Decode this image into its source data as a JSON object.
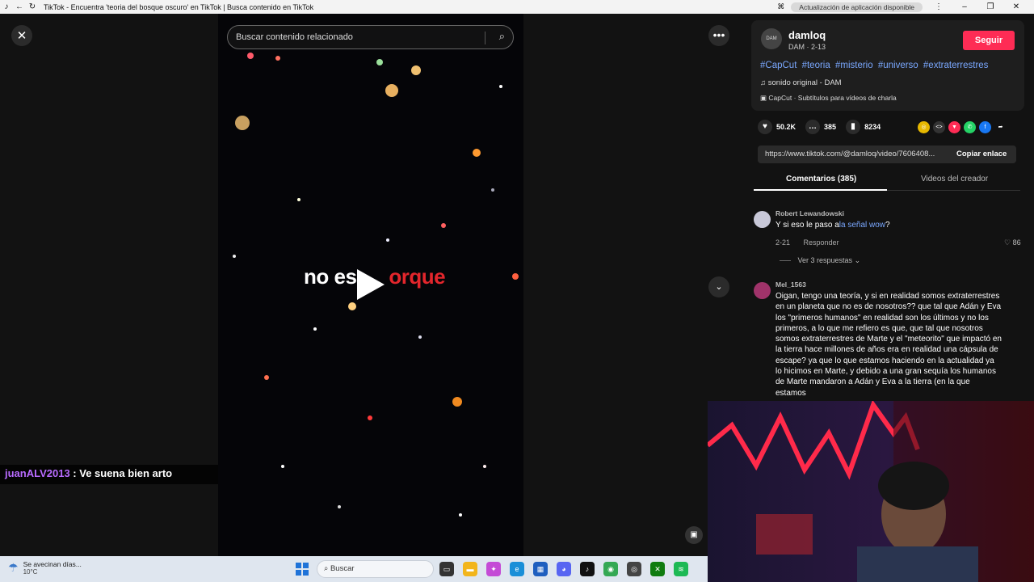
{
  "window": {
    "title": "TikTok - Encuentra 'teoria del bosque oscuro' en TikTok | Busca contenido en TikTok",
    "update_notice": "Actualización de aplicación disponible"
  },
  "video": {
    "search_placeholder": "Buscar contenido relacionado",
    "caption_part1": "no es",
    "caption_part2": "orque",
    "chat_user": "juanALV2013",
    "chat_message": " : Ve suena bien arto"
  },
  "creator": {
    "name": "damloq",
    "sub": "DAM · 2-13",
    "avatar_text": "DAM",
    "follow_label": "Seguir",
    "hashtags": [
      "#CapCut",
      "#teoria",
      "#misterio",
      "#universo",
      "#extraterrestres"
    ],
    "sound": "sonido original - DAM",
    "capcut": "CapCut · Subtítulos para vídeos de charla"
  },
  "stats": {
    "likes": "50.2K",
    "comments": "385",
    "saves": "8234"
  },
  "link": {
    "url": "https://www.tiktok.com/@damloq/video/7606408...",
    "copy_label": "Copiar enlace"
  },
  "tabs": {
    "comments": "Comentarios (385)",
    "creator_videos": "Videos del creador"
  },
  "comments": [
    {
      "user": "Robert Lewandowski",
      "text_pre": "Y si eso le paso a",
      "text_link": "la señal wow",
      "text_post": "?",
      "date": "2-21",
      "reply_label": "Responder",
      "likes": "86",
      "view_replies": "Ver 3 respuestas"
    },
    {
      "user": "Mel_1563",
      "text": "Oigan, tengo una teoría, y si en realidad somos extraterrestres en un planeta que no es de nosotros?? que tal que Adán y Eva los \"primeros humanos\" en realidad son los últimos y no los primeros, a lo que me refiero es que, que tal que nosotros somos extraterrestres de Marte y el \"meteorito\" que impactó en la tierra hace millones de años era en realidad una cápsula de escape? ya que lo que estamos haciendo en la actualidad ya lo hicimos en Marte, y debido a una gran sequía los humanos de Marte mandaron a Adán y Eva a la tierra (en la que estamos"
    }
  ],
  "taskbar": {
    "weather_text": "Se avecinan días...",
    "weather_temp": "10°C",
    "search_label": "Buscar"
  },
  "colors": {
    "accent": "#fe2c55",
    "link": "#7aa8ff",
    "chat_user": "#b86bff",
    "caption_red": "#e3262c"
  }
}
